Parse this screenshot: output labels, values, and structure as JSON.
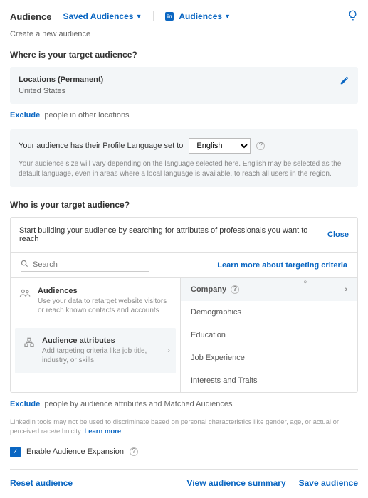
{
  "header": {
    "title": "Audience",
    "saved_dd": "Saved Audiences",
    "li_dd": "Audiences",
    "subtitle": "Create a new audience"
  },
  "where": {
    "label": "Where is your target audience?",
    "card_title": "Locations (Permanent)",
    "card_value": "United States",
    "exclude_action": "Exclude",
    "exclude_text": "people in other locations"
  },
  "lang": {
    "row_prefix": "Your audience has their Profile Language set to",
    "selected": "English",
    "help": "Your audience size will vary depending on the language selected here. English may be selected as the default language, even in areas where a local language is available, to reach all users in the region."
  },
  "who": {
    "label": "Who is your target audience?",
    "panel_intro": "Start building your audience by searching for attributes of professionals you want to reach",
    "close": "Close",
    "search_placeholder": "Search",
    "learn": "Learn more about targeting criteria",
    "left": {
      "audiences_title": "Audiences",
      "audiences_desc": "Use your data to retarget website visitors or reach known contacts and accounts",
      "attrs_title": "Audience attributes",
      "attrs_desc": "Add targeting criteria like job title, industry, or skills"
    },
    "categories": [
      "Company",
      "Demographics",
      "Education",
      "Job Experience",
      "Interests and Traits"
    ]
  },
  "exclude2": {
    "action": "Exclude",
    "text": "people by audience attributes and Matched Audiences"
  },
  "disclaimer": {
    "text": "LinkedIn tools may not be used to discriminate based on personal characteristics like gender, age, or actual or perceived race/ethnicity.",
    "link": "Learn more"
  },
  "expansion": {
    "label": "Enable Audience Expansion"
  },
  "footer": {
    "reset": "Reset audience",
    "summary": "View audience summary",
    "save": "Save audience"
  }
}
